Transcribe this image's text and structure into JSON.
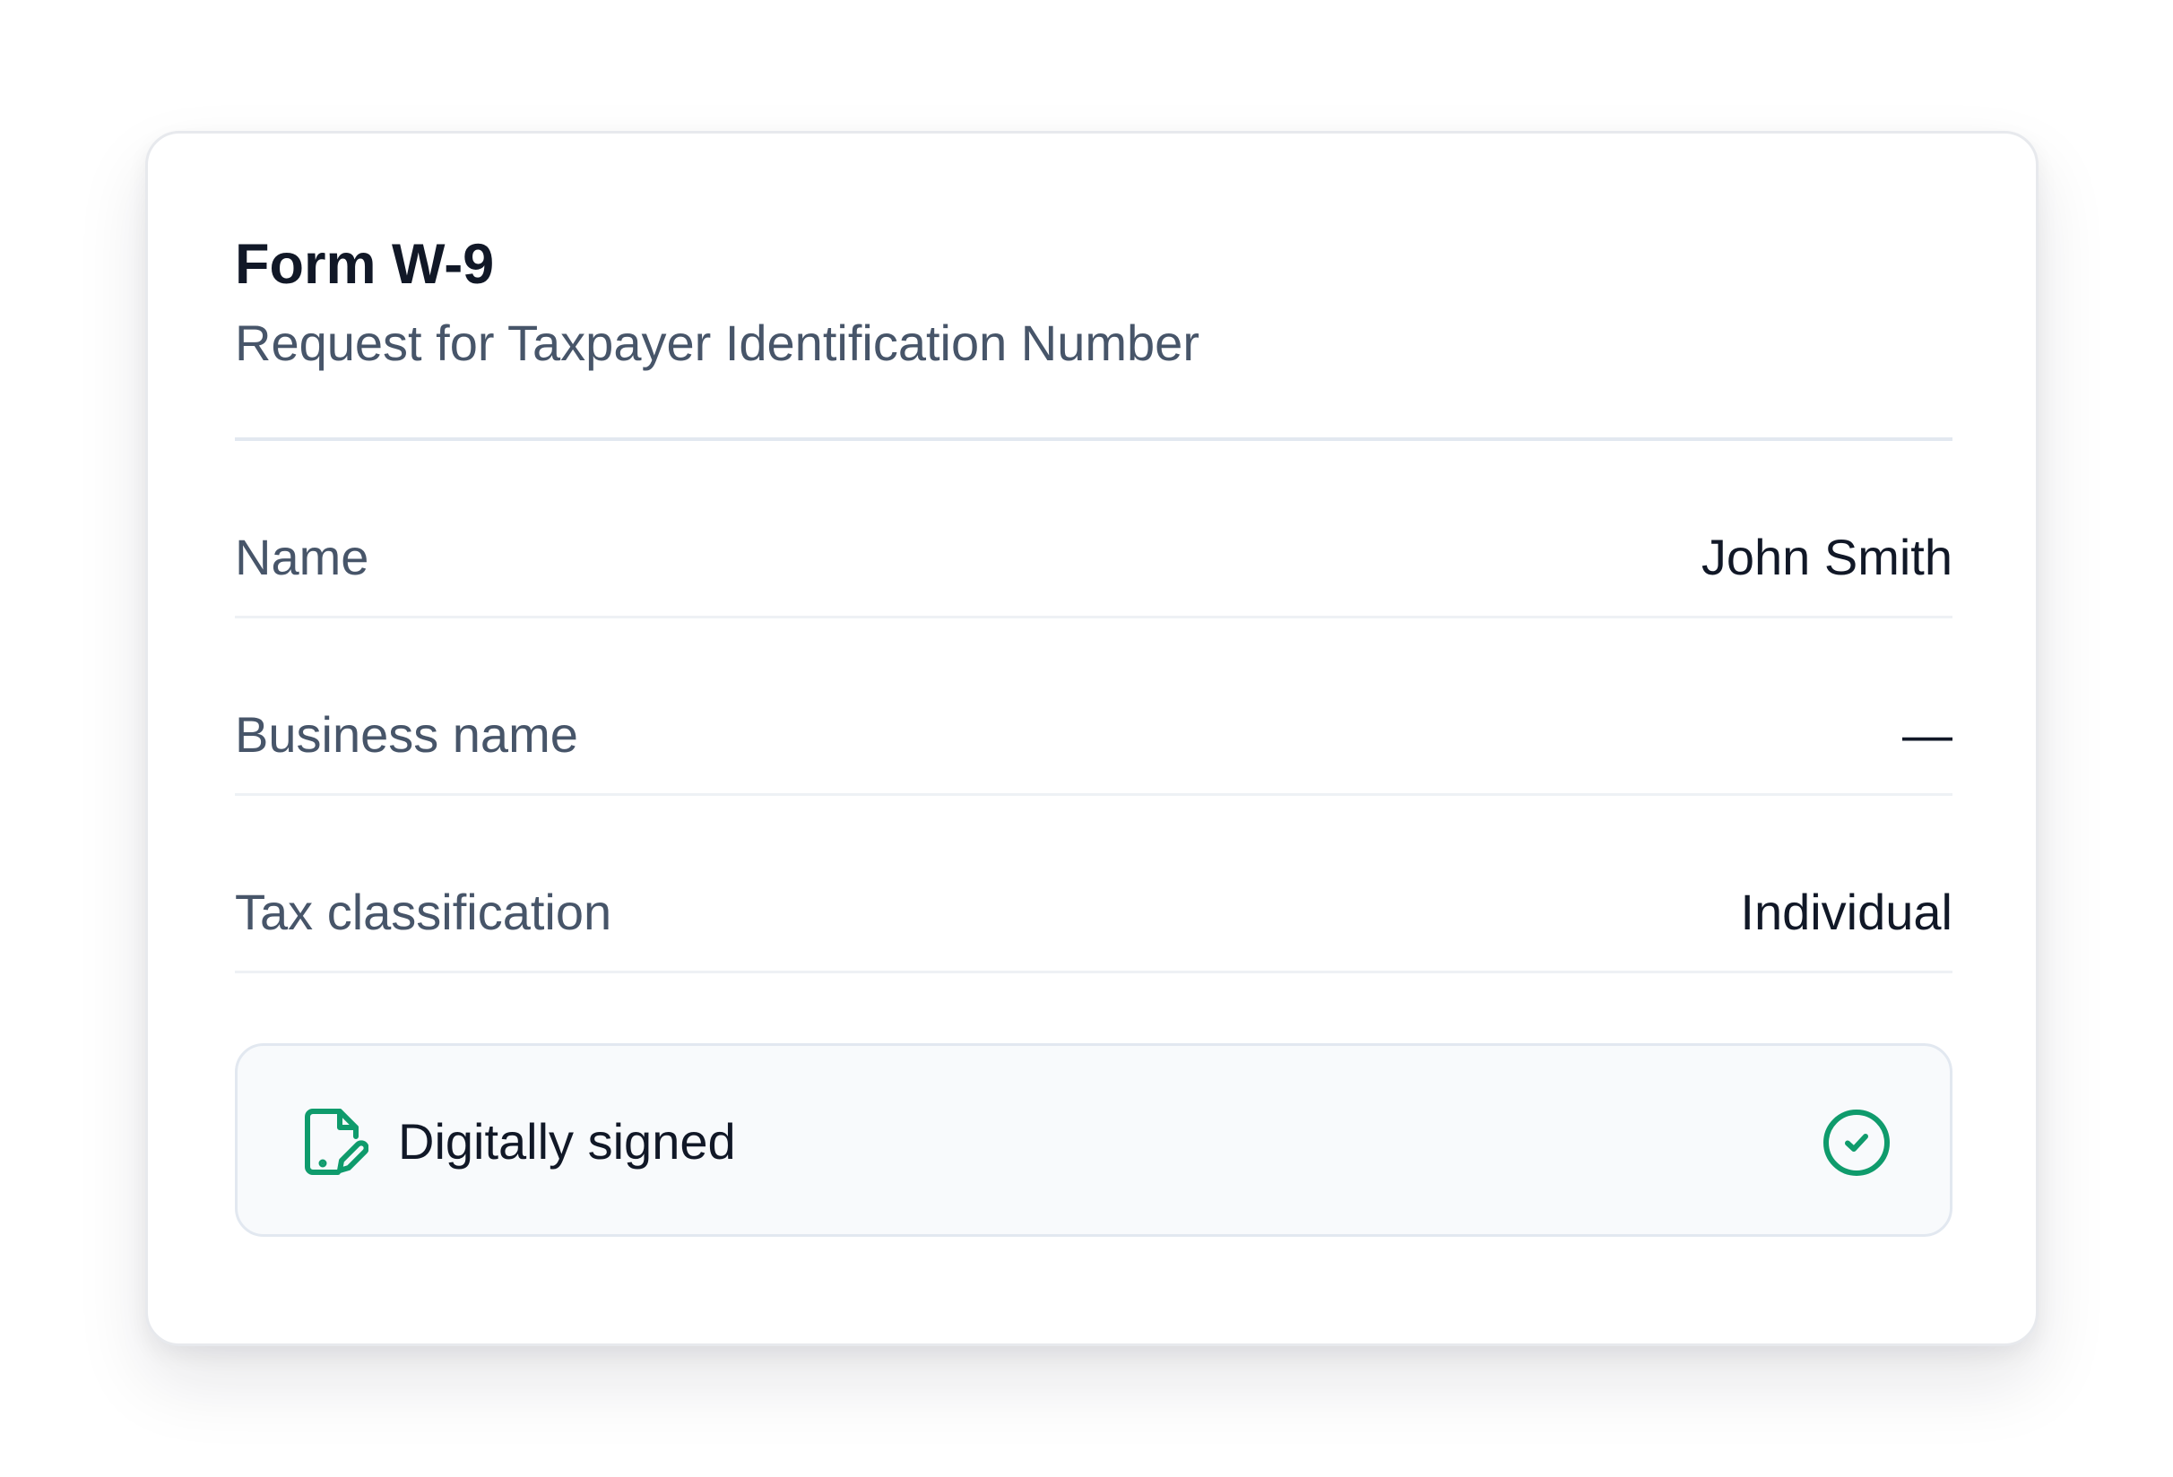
{
  "form": {
    "title": "Form W-9",
    "subtitle": "Request for Taxpayer Identification Number"
  },
  "fields": [
    {
      "label": "Name",
      "value": "John Smith"
    },
    {
      "label": "Business name",
      "value": "—"
    },
    {
      "label": "Tax classification",
      "value": "Individual"
    }
  ],
  "signature": {
    "label": "Digitally signed",
    "icon": "signed-document-icon",
    "status_icon": "check-circle-icon",
    "accent_color": "#0f9b6c"
  }
}
